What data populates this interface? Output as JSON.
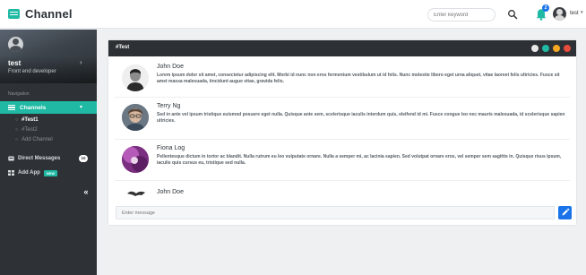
{
  "app": {
    "title": "Channel",
    "accent": "#1fb9a4",
    "brand_icon": "app-logo-icon"
  },
  "header": {
    "search_placeholder": "Enter keyword",
    "search_icon": "search-icon",
    "notification_icon": "bell-icon",
    "notification_count": "2",
    "user_name": "test",
    "user_menu_icon": "caret-down-icon"
  },
  "sidebar": {
    "profile": {
      "name": "test",
      "role": "Front end developer"
    },
    "navigation_heading": "Navigation",
    "channels": {
      "label": "Channels",
      "items": [
        {
          "label": "#Test1",
          "active": true
        },
        {
          "label": "#Test2",
          "active": false
        },
        {
          "label": "Add Channel",
          "active": false
        }
      ]
    },
    "direct_messages": {
      "label": "Direct Messages",
      "count": "10"
    },
    "add_app": {
      "label": "Add App",
      "badge": "NEW"
    }
  },
  "channel": {
    "title": "#Test",
    "window_dots": [
      "#e8e8e8",
      "#1fb9a4",
      "#f5a623",
      "#e74c3c"
    ],
    "messages": [
      {
        "author": "John Doe",
        "text": "Lorem ipsum dolor sit amet, consectetur adipiscing elit. Morbi id nunc non eros fermentum vestibulum ut id felis. Nunc molestie libero eget urna aliquet, vitae laoreet felis ultricies. Fusce sit amet massa malesuada, tincidunt augue vitae, gravida felis."
      },
      {
        "author": "Terry Ng",
        "text": "Sed in ante vel ipsum tristique euismod posuere eget nulla. Quisque ante sem, scelerisque iaculis interdum quis, eleifend id mi. Fusce congue leo nec mauris malesuada, id scelerisque sapien ultricies."
      },
      {
        "author": "Fiona Log",
        "text": "Pellentesque dictum in tortor ac blandit. Nulla rutrum eu leo vulputate ornare. Nulla a semper mi, ac lacinia sapien. Sed volutpat ornare eros, vel semper sem sagittis in. Quisque risus ipsum, iaculis quis cursus eu, tristique sed nulla."
      },
      {
        "author": "John Doe",
        "text": ""
      }
    ],
    "compose_placeholder": "Enter message",
    "send_icon": "pencil-icon"
  }
}
